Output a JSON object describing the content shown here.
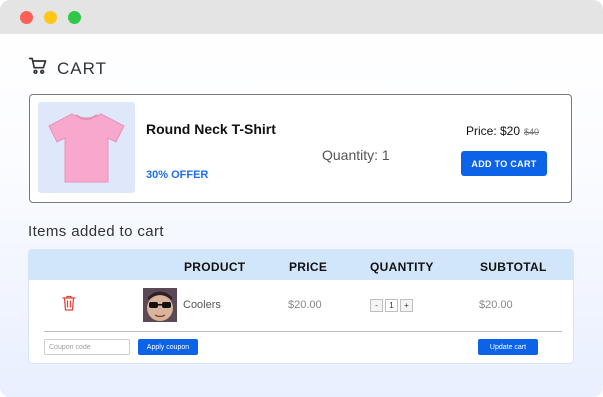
{
  "header": {
    "title": "CART",
    "icon": "shopping-cart-icon"
  },
  "product": {
    "name": "Round Neck T-Shirt",
    "offer": "30% OFFER",
    "quantity_text": "Quantity: 1",
    "price_label": "Price: $20",
    "original_price": "$40",
    "add_to_cart_label": "ADD TO CART",
    "image_icon": "tshirt-image",
    "shirt_color": "#f7a8cc"
  },
  "cart": {
    "heading": "Items added to cart",
    "columns": [
      "PRODUCT",
      "PRICE",
      "QUANTITY",
      "SUBTOTAL"
    ],
    "rows": [
      {
        "remove_icon": "trash-icon",
        "name": "Coolers",
        "price": "$20.00",
        "quantity": "1",
        "minus": "-",
        "plus": "+",
        "subtotal": "$20.00"
      }
    ],
    "coupon_placeholder": "Coupon code",
    "apply_coupon_label": "Apply coupon",
    "update_cart_label": "Update cart"
  },
  "colors": {
    "accent": "#0d63e8",
    "table_header_bg": "#d2e6fb",
    "trash": "#e0443b"
  }
}
